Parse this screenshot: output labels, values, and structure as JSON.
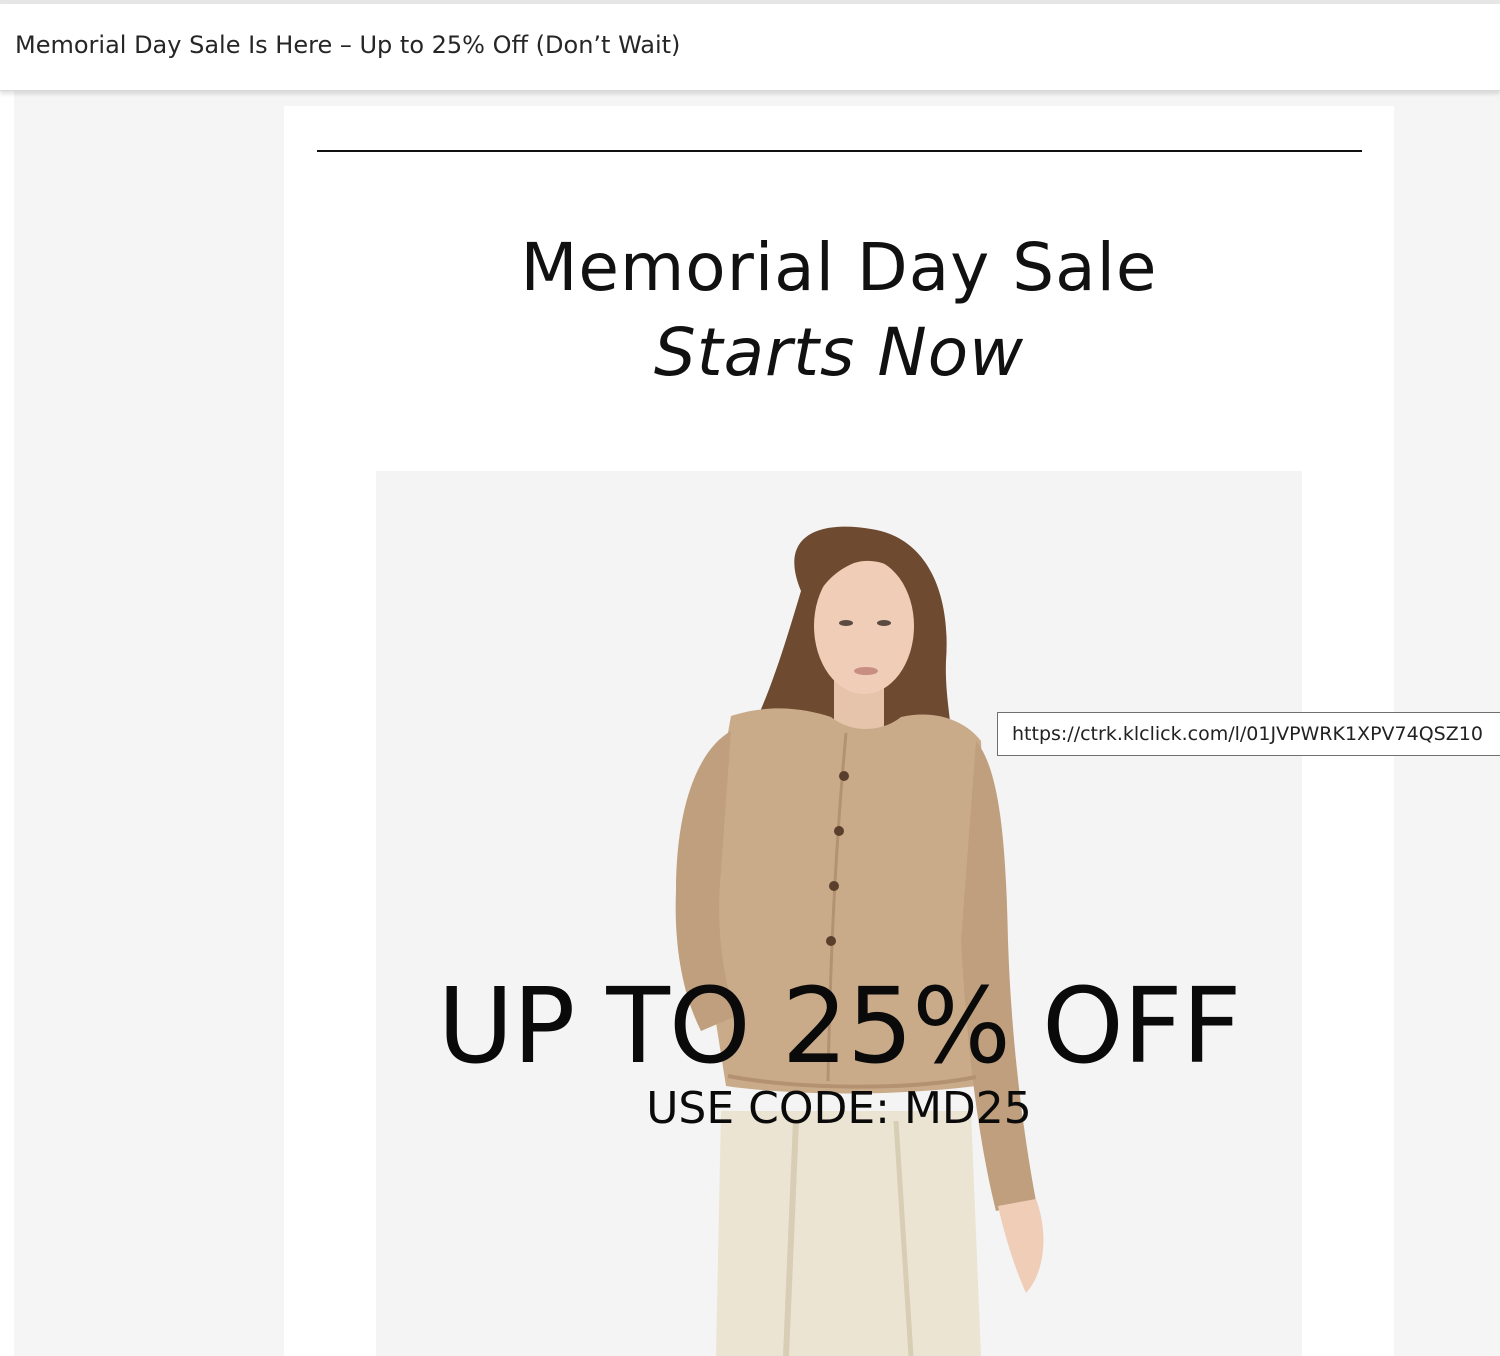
{
  "message": {
    "subject": "Memorial Day Sale Is Here – Up to 25% Off (Don’t Wait)"
  },
  "email": {
    "headline": "Memorial Day Sale",
    "subheadline": "Starts Now",
    "hero": {
      "offer": "UP TO 25% OFF",
      "code": "USE CODE: MD25"
    }
  },
  "tooltip": {
    "url": "https://ctrk.klclick.com/l/01JVPWRK1XPV74QSZ10"
  },
  "colors": {
    "text": "#111111",
    "hero_background": "#f4f4f4",
    "cardigan": "#c9ab8a",
    "skirt": "#ece4d2",
    "hair": "#6e4a30"
  },
  "icons": {
    "hero_image": "model-wearing-cardigan-photo"
  }
}
